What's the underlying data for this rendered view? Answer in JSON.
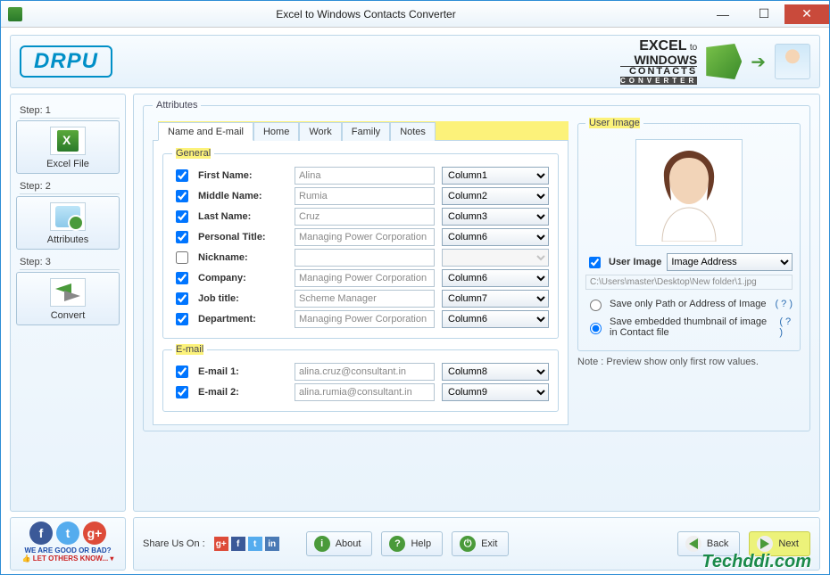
{
  "title": "Excel to Windows Contacts Converter",
  "brand": "DRPU",
  "logo": {
    "l1": "EXCEL",
    "to": "to",
    "l2": "WINDOWS",
    "l3": "CONTACTS",
    "l4": "CONVERTER"
  },
  "sidebar": {
    "step1": {
      "label": "Step: 1",
      "btn": "Excel File"
    },
    "step2": {
      "label": "Step: 2",
      "btn": "Attributes"
    },
    "step3": {
      "label": "Step: 3",
      "btn": "Convert"
    }
  },
  "attributes_legend": "Attributes",
  "tabs": [
    "Name and E-mail",
    "Home",
    "Work",
    "Family",
    "Notes"
  ],
  "general_legend": "General",
  "email_legend": "E-mail",
  "fields": {
    "first": {
      "lbl": "First Name:",
      "val": "Alina",
      "col": "Column1",
      "ck": true
    },
    "middle": {
      "lbl": "Middle Name:",
      "val": "Rumia",
      "col": "Column2",
      "ck": true
    },
    "last": {
      "lbl": "Last Name:",
      "val": "Cruz",
      "col": "Column3",
      "ck": true
    },
    "ptitle": {
      "lbl": "Personal Title:",
      "val": "Managing Power Corporation",
      "col": "Column6",
      "ck": true
    },
    "nick": {
      "lbl": "Nickname:",
      "val": "",
      "col": "",
      "ck": false
    },
    "company": {
      "lbl": "Company:",
      "val": "Managing Power Corporation",
      "col": "Column6",
      "ck": true
    },
    "job": {
      "lbl": "Job title:",
      "val": "Scheme Manager",
      "col": "Column7",
      "ck": true
    },
    "dept": {
      "lbl": "Department:",
      "val": "Managing Power Corporation",
      "col": "Column6",
      "ck": true
    },
    "email1": {
      "lbl": "E-mail 1:",
      "val": "alina.cruz@consultant.in",
      "col": "Column8",
      "ck": true
    },
    "email2": {
      "lbl": "E-mail 2:",
      "val": "alina.rumia@consultant.in",
      "col": "Column9",
      "ck": true
    }
  },
  "userimg": {
    "legend": "User Image",
    "ck_label": "User Image",
    "sel": "Image Address",
    "path": "C:\\Users\\master\\Desktop\\New folder\\1.jpg",
    "opt1": "Save only Path or Address of Image",
    "opt2": "Save embedded thumbnail of image in Contact file",
    "q": "( ? )"
  },
  "note": "Note : Preview show only first row values.",
  "footer": {
    "good_bad": "WE ARE GOOD OR BAD?",
    "let_others": "LET OTHERS KNOW...",
    "share": "Share Us On :",
    "about": "About",
    "help": "Help",
    "exit": "Exit",
    "back": "Back",
    "next": "Next"
  },
  "watermark": "Techddi.com"
}
